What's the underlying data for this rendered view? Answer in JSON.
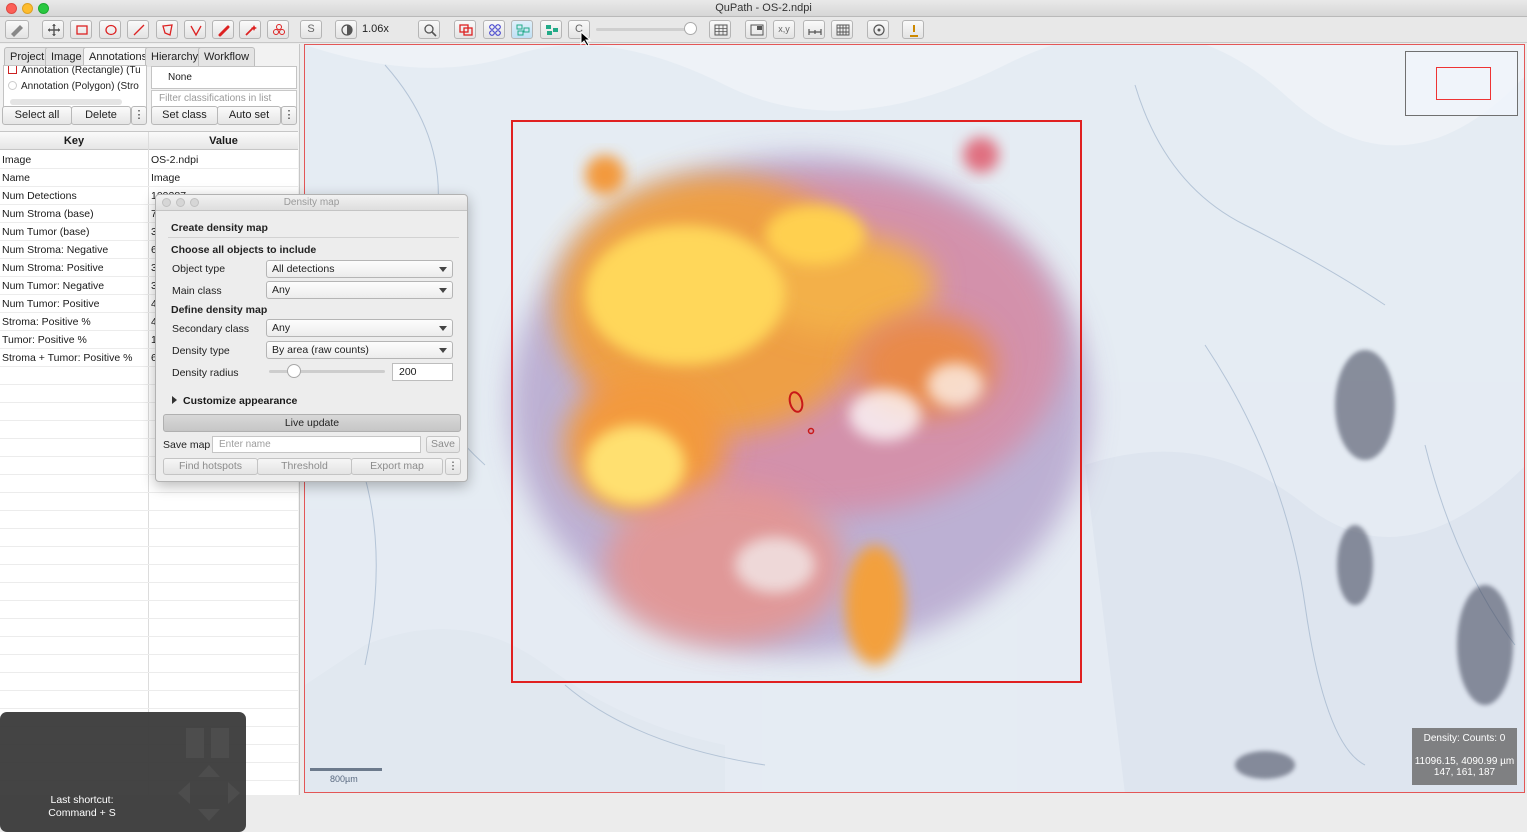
{
  "window": {
    "title": "QuPath - OS-2.ndpi"
  },
  "toolbar": {
    "zoom_label": "1.06x",
    "buttons": [
      {
        "name": "move-tool",
        "icon": "pan-icon"
      },
      {
        "name": "rectangle-tool",
        "icon": "rectangle-icon"
      },
      {
        "name": "ellipse-tool",
        "icon": "ellipse-icon"
      },
      {
        "name": "line-tool",
        "icon": "line-icon"
      },
      {
        "name": "polygon-tool",
        "icon": "polygon-icon"
      },
      {
        "name": "polyline-tool",
        "icon": "polyline-icon"
      },
      {
        "name": "brush-tool",
        "icon": "brush-icon"
      },
      {
        "name": "wand-tool",
        "icon": "wand-icon"
      },
      {
        "name": "points-tool",
        "icon": "points-icon"
      },
      {
        "name": "selection-mode",
        "icon": "selection-icon",
        "text": "S"
      },
      {
        "name": "brightness-contrast",
        "icon": "contrast-icon"
      },
      {
        "name": "zoom-to-fit",
        "icon": "magnify-icon"
      },
      {
        "name": "show-annotations",
        "icon": "annotations-icon"
      },
      {
        "name": "show-tma-grid",
        "icon": "tma-icon"
      },
      {
        "name": "show-detections",
        "icon": "detections-icon"
      },
      {
        "name": "fill-detections",
        "icon": "fill-icon"
      },
      {
        "name": "show-pixel-classification",
        "icon": "pixel-icon",
        "text": "C"
      },
      {
        "name": "grid",
        "icon": "grid-icon"
      },
      {
        "name": "overview",
        "icon": "overview-icon"
      },
      {
        "name": "location",
        "icon": "xy-icon",
        "text": "x,y"
      },
      {
        "name": "scalebar",
        "icon": "scalebar-icon"
      },
      {
        "name": "counting-grid",
        "icon": "counting-icon"
      },
      {
        "name": "measurement",
        "icon": "measure-icon"
      },
      {
        "name": "log",
        "icon": "log-icon"
      }
    ]
  },
  "tabs": [
    "Project",
    "Image",
    "Annotations",
    "Hierarchy",
    "Workflow"
  ],
  "annotations": {
    "items": [
      "Annotation (Rectangle) (Tu",
      "Annotation (Polygon) (Stro"
    ],
    "class_selected": "None",
    "filter_placeholder": "Filter classifications in list",
    "select_all": "Select all",
    "delete": "Delete",
    "set_class": "Set class",
    "auto_set": "Auto set",
    "more": "⋮"
  },
  "properties": {
    "headers": {
      "key": "Key",
      "value": "Value"
    },
    "rows": [
      {
        "k": "Image",
        "v": "OS-2.ndpi"
      },
      {
        "k": "Name",
        "v": "Image"
      },
      {
        "k": "Num Detections",
        "v": "109287"
      },
      {
        "k": "Num Stroma (base)",
        "v": "7"
      },
      {
        "k": "Num Tumor (base)",
        "v": "3"
      },
      {
        "k": "Num Stroma: Negative",
        "v": "6"
      },
      {
        "k": "Num Stroma: Positive",
        "v": "3"
      },
      {
        "k": "Num Tumor: Negative",
        "v": "3"
      },
      {
        "k": "Num Tumor: Positive",
        "v": "4"
      },
      {
        "k": "Stroma: Positive %",
        "v": "4"
      },
      {
        "k": "Tumor: Positive %",
        "v": "1"
      },
      {
        "k": "Stroma + Tumor: Positive %",
        "v": "6"
      }
    ]
  },
  "dialog": {
    "title": "Density map",
    "create": "Create density map",
    "choose": "Choose all objects to include",
    "object_type_label": "Object type",
    "object_type": "All detections",
    "main_class_label": "Main class",
    "main_class": "Any",
    "define": "Define density map",
    "secondary_class_label": "Secondary class",
    "secondary_class": "Any",
    "density_type_label": "Density type",
    "density_type": "By area (raw counts)",
    "density_radius_label": "Density radius",
    "density_radius": "200",
    "customize": "Customize appearance",
    "live_update": "Live update",
    "save_map_label": "Save map",
    "name_placeholder": "Enter name",
    "save": "Save",
    "find_hotspots": "Find hotspots",
    "threshold": "Threshold",
    "export_map": "Export map",
    "more": "⋮"
  },
  "viewer": {
    "scalebar": "800µm",
    "density_info": "Density: Counts: 0",
    "coords": "11096.15, 4090.99 µm",
    "rgb": "147, 161, 187"
  },
  "shortcut": {
    "line1": "Last shortcut:",
    "line2": "Command + S"
  },
  "colors": {
    "annotation": "#e02020",
    "hot": "#ffd040",
    "warm": "#f08a40",
    "cool": "#b3a0cc"
  }
}
